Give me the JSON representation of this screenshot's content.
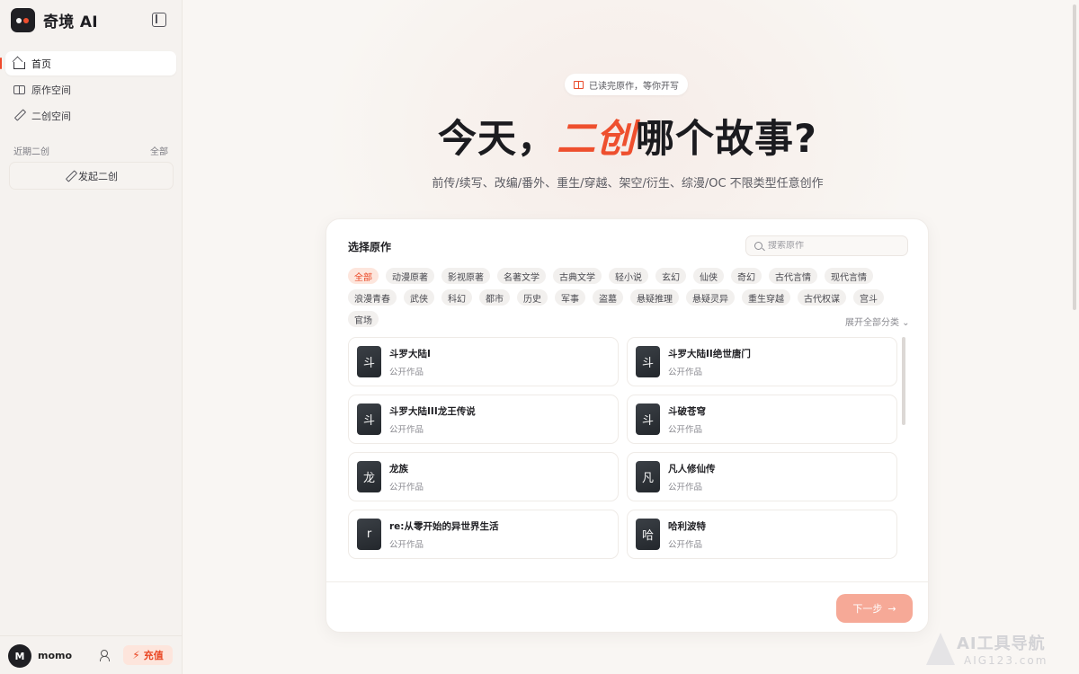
{
  "app": {
    "name": "奇境 AI"
  },
  "sidebar": {
    "nav": [
      {
        "label": "首页",
        "icon": "home-icon",
        "active": true
      },
      {
        "label": "原作空间",
        "icon": "book-icon",
        "active": false
      },
      {
        "label": "二创空间",
        "icon": "pen-icon",
        "active": false
      }
    ],
    "recent_title": "近期二创",
    "recent_all": "全部",
    "new_label": "发起二创"
  },
  "user": {
    "avatar_letter": "M",
    "name": "momo",
    "recharge_label": "充值"
  },
  "hero": {
    "pill_text": "已读完原作，等你开写",
    "headline_pre": "今天，",
    "headline_accent": "二创",
    "headline_post": "哪个故事?",
    "subline": "前传/续写、改编/番外、重生/穿越、架空/衍生、综漫/OC 不限类型任意创作"
  },
  "picker": {
    "title": "选择原作",
    "search_placeholder": "搜索原作",
    "tags": [
      "全部",
      "动漫原著",
      "影视原著",
      "名著文学",
      "古典文学",
      "轻小说",
      "玄幻",
      "仙侠",
      "奇幻",
      "古代言情",
      "现代言情",
      "浪漫青春",
      "武侠",
      "科幻",
      "都市",
      "历史",
      "军事",
      "盗墓",
      "悬疑推理",
      "悬疑灵异",
      "重生穿越",
      "古代权谋",
      "宫斗",
      "官场"
    ],
    "expand_label": "展开全部分类 ⌄",
    "works": [
      {
        "thumb": "斗",
        "title": "斗罗大陆I",
        "sub": "公开作品"
      },
      {
        "thumb": "斗",
        "title": "斗罗大陆II绝世唐门",
        "sub": "公开作品"
      },
      {
        "thumb": "斗",
        "title": "斗罗大陆III龙王传说",
        "sub": "公开作品"
      },
      {
        "thumb": "斗",
        "title": "斗破苍穹",
        "sub": "公开作品"
      },
      {
        "thumb": "龙",
        "title": "龙族",
        "sub": "公开作品"
      },
      {
        "thumb": "凡",
        "title": "凡人修仙传",
        "sub": "公开作品"
      },
      {
        "thumb": "r",
        "title": "re:从零开始的异世界生活",
        "sub": "公开作品"
      },
      {
        "thumb": "哈",
        "title": "哈利波特",
        "sub": "公开作品"
      }
    ],
    "next_label": "下一步"
  },
  "watermark": {
    "line1": "AI工具导航",
    "line2": "AIG123.com"
  },
  "colors": {
    "accent": "#ee4f2e",
    "next_button": "#f6a997",
    "tag_active_bg": "#fde6dd"
  }
}
